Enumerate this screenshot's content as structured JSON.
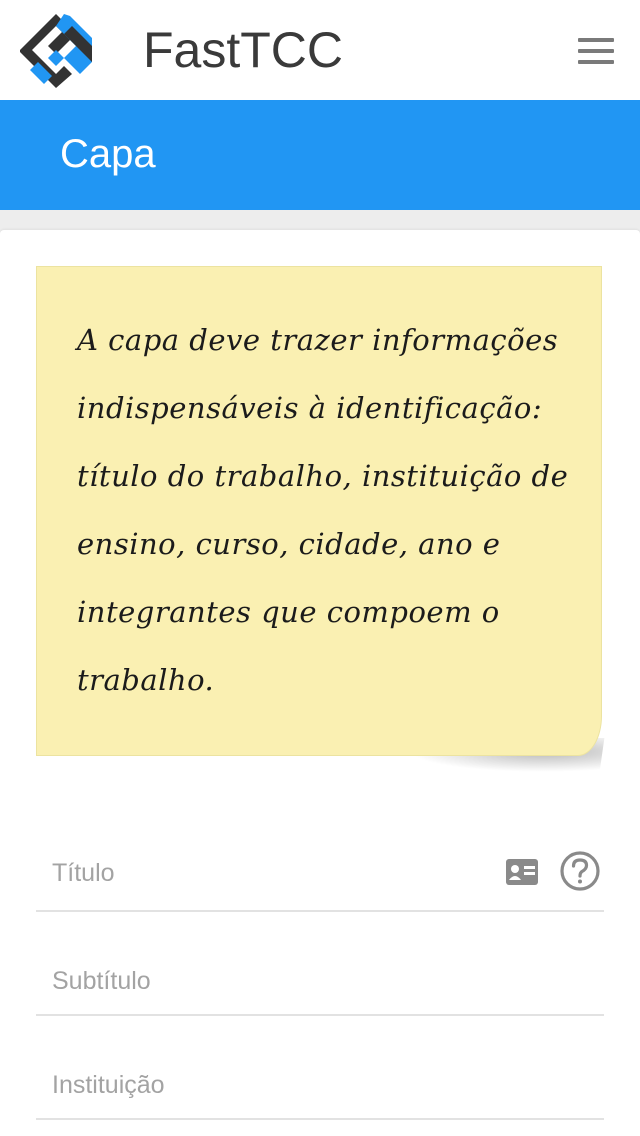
{
  "app": {
    "title": "FastTCC",
    "logo_icon": "fasttcc-logo-icon",
    "menu_icon": "hamburger-menu-icon"
  },
  "section": {
    "title": "Capa",
    "color": "#2196f3"
  },
  "note": {
    "text": "A capa deve trazer informações indispensáveis à identificação: título do trabalho, instituição de ensino, curso, cidade, ano e integrantes que compoem o trabalho.",
    "background": "#faf0b2"
  },
  "form": {
    "fields": [
      {
        "placeholder": "Título",
        "value": "",
        "icons": [
          "id-card-icon",
          "help-circle-icon"
        ]
      },
      {
        "placeholder": "Subtítulo",
        "value": ""
      },
      {
        "placeholder": "Instituição",
        "value": ""
      }
    ]
  }
}
